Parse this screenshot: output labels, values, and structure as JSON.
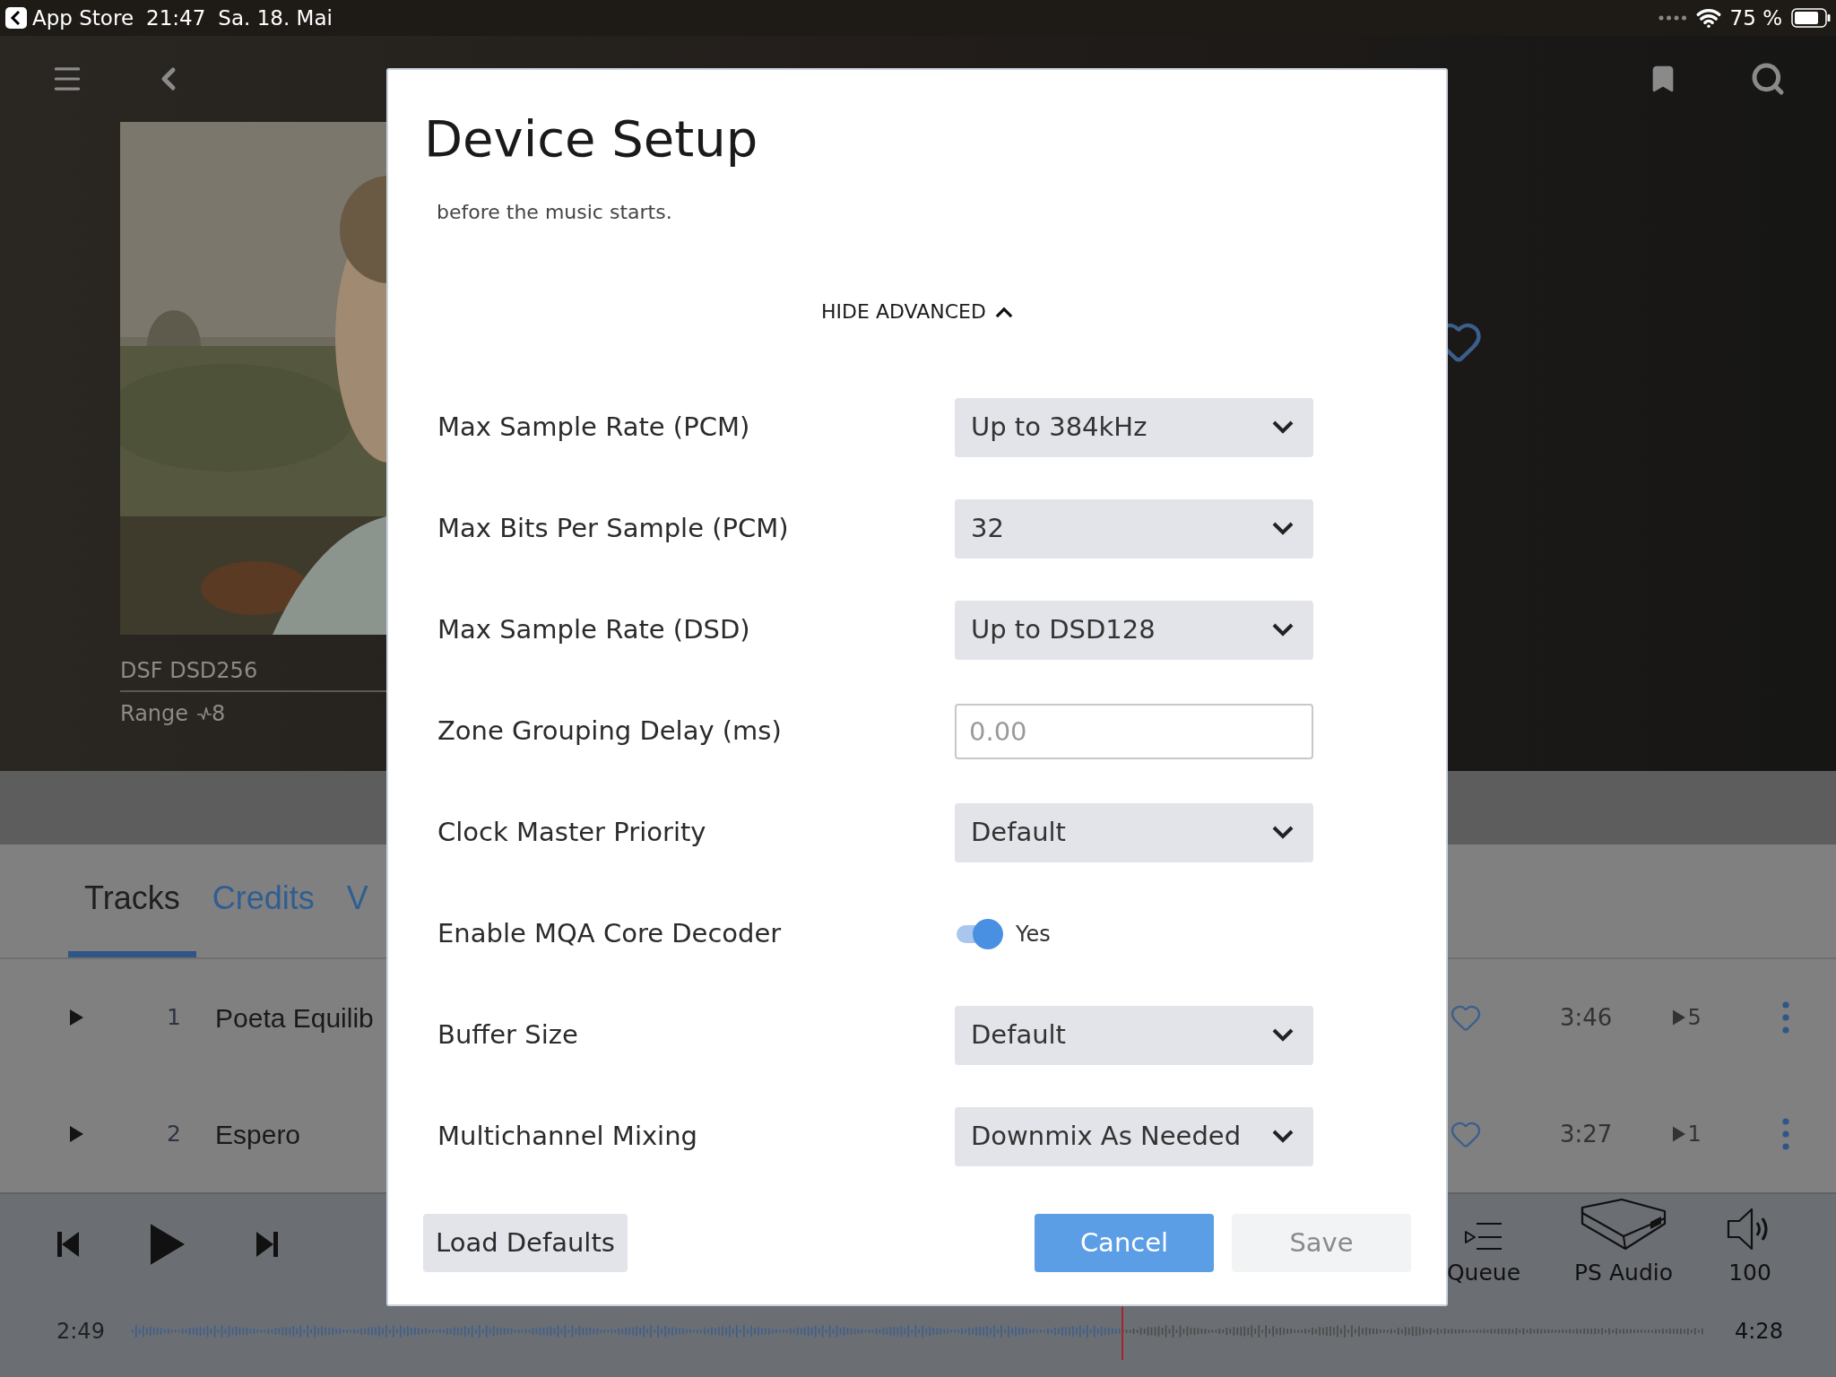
{
  "status_bar": {
    "back_app": "App Store",
    "time": "21:47",
    "date": "Sa. 18. Mai",
    "battery": "75 %"
  },
  "album": {
    "format": "DSF DSD256",
    "range_label": "Range",
    "range_value": "8"
  },
  "tabs": [
    {
      "label": "Tracks",
      "selected": true
    },
    {
      "label": "Credits",
      "selected": false
    },
    {
      "label": "V",
      "selected": false
    }
  ],
  "tracks": [
    {
      "number": "1",
      "title": "Poeta Equilib",
      "duration": "3:46",
      "plays": "5"
    },
    {
      "number": "2",
      "title": "Espero",
      "duration": "3:27",
      "plays": "1"
    }
  ],
  "player": {
    "elapsed": "2:49",
    "total": "4:28",
    "level": 0.63,
    "queue_label": "Queue",
    "device": "PS Audio",
    "volume": "100"
  },
  "dialog": {
    "title": "Device Setup",
    "subtitle": "before the music starts.",
    "advanced_toggle": "HIDE ADVANCED",
    "expanded": true,
    "settings": [
      {
        "kind": "select",
        "label": "Max Sample Rate (PCM)",
        "value": "Up to 384kHz"
      },
      {
        "kind": "select",
        "label": "Max Bits Per Sample (PCM)",
        "value": "32"
      },
      {
        "kind": "select",
        "label": "Max Sample Rate (DSD)",
        "value": "Up to DSD128"
      },
      {
        "kind": "input",
        "label": "Zone Grouping Delay (ms)",
        "placeholder": "0.00"
      },
      {
        "kind": "select",
        "label": "Clock Master Priority",
        "value": "Default"
      },
      {
        "kind": "toggle",
        "label": "Enable MQA Core Decoder",
        "on": true,
        "value": "Yes"
      },
      {
        "kind": "select",
        "label": "Buffer Size",
        "value": "Default"
      },
      {
        "kind": "select",
        "label": "Multichannel Mixing",
        "value": "Downmix As Needed"
      }
    ],
    "buttons": [
      {
        "label": "Load Defaults",
        "kind": "secondary"
      },
      {
        "label": "Cancel",
        "kind": "primary"
      },
      {
        "label": "Save",
        "kind": "disabled"
      }
    ]
  }
}
